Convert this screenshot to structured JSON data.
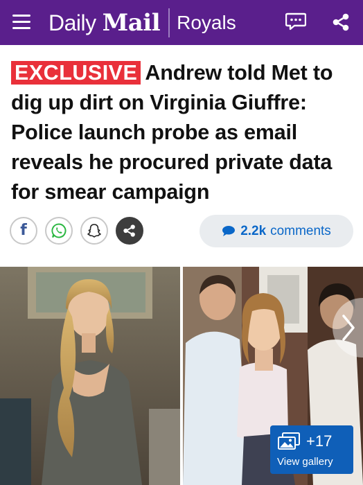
{
  "header": {
    "brand_daily": "Daily",
    "brand_mail": "Mail",
    "section": "Royals",
    "bg_color": "#5a1f8c",
    "icons": [
      "menu-icon",
      "chat-icon",
      "share-icon"
    ]
  },
  "article": {
    "tag": "EXCLUSIVE",
    "title": "Andrew told Met to dig up dirt on Virginia Giuffre: Police launch probe as email reveals he procured private data for smear campaign",
    "tag_color": "#e9303a"
  },
  "social": {
    "buttons": [
      "facebook-icon",
      "whatsapp-icon",
      "snapchat-icon",
      "share-icon"
    ],
    "comments_count": "2.2k",
    "comments_label": "comments",
    "comments_color": "#0a67c8"
  },
  "gallery": {
    "count": "+17",
    "label": "View gallery",
    "color": "#0f5fb8"
  }
}
